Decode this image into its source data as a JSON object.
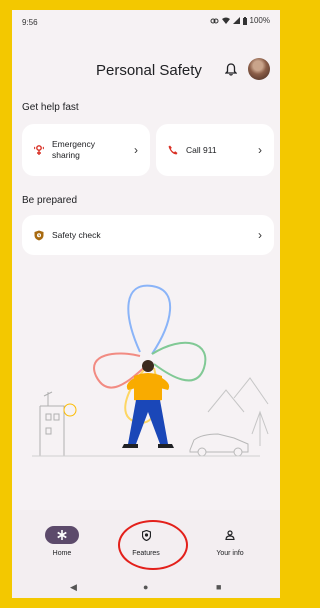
{
  "status": {
    "time": "9:56",
    "battery": "100%"
  },
  "header": {
    "title": "Personal Safety"
  },
  "sections": {
    "help": {
      "title": "Get help fast",
      "emergency_line1": "Emergency",
      "emergency_line2": "sharing",
      "call_label": "Call 911"
    },
    "prepared": {
      "title": "Be prepared",
      "safety_check": "Safety check"
    }
  },
  "nav": {
    "home": "Home",
    "features": "Features",
    "your_info": "Your info"
  },
  "icons": {
    "bell": "bell-icon",
    "emergency": "emergency-sharing-icon",
    "phone": "phone-icon",
    "shield": "shield-icon",
    "asterisk": "asterisk-icon",
    "person": "person-icon"
  },
  "colors": {
    "frame": "#f3c800",
    "accent_red": "#d93025",
    "nav_active": "#5c4a6b",
    "highlight_circle": "#e3201b"
  }
}
